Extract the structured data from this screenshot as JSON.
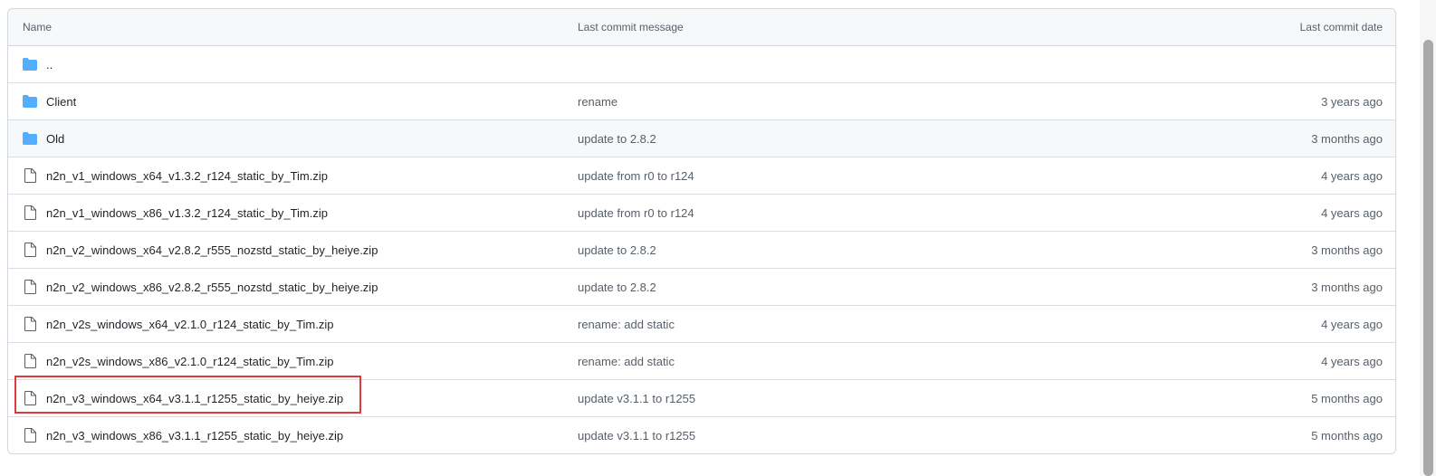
{
  "table": {
    "headers": {
      "name": "Name",
      "message": "Last commit message",
      "date": "Last commit date"
    },
    "parent_link": "..",
    "rows": [
      {
        "type": "folder",
        "icon": "folder-icon",
        "name": "Client",
        "message": "rename",
        "date": "3 years ago"
      },
      {
        "type": "folder",
        "icon": "folder-icon",
        "name": "Old",
        "message": "update to 2.8.2",
        "date": "3 months ago"
      },
      {
        "type": "file",
        "icon": "file-icon",
        "name": "n2n_v1_windows_x64_v1.3.2_r124_static_by_Tim.zip",
        "message": "update from r0 to r124",
        "date": "4 years ago"
      },
      {
        "type": "file",
        "icon": "file-icon",
        "name": "n2n_v1_windows_x86_v1.3.2_r124_static_by_Tim.zip",
        "message": "update from r0 to r124",
        "date": "4 years ago"
      },
      {
        "type": "file",
        "icon": "file-icon",
        "name": "n2n_v2_windows_x64_v2.8.2_r555_nozstd_static_by_heiye.zip",
        "message": "update to 2.8.2",
        "date": "3 months ago"
      },
      {
        "type": "file",
        "icon": "file-icon",
        "name": "n2n_v2_windows_x86_v2.8.2_r555_nozstd_static_by_heiye.zip",
        "message": "update to 2.8.2",
        "date": "3 months ago"
      },
      {
        "type": "file",
        "icon": "file-icon",
        "name": "n2n_v2s_windows_x64_v2.1.0_r124_static_by_Tim.zip",
        "message": "rename: add static",
        "date": "4 years ago"
      },
      {
        "type": "file",
        "icon": "file-icon",
        "name": "n2n_v2s_windows_x86_v2.1.0_r124_static_by_Tim.zip",
        "message": "rename: add static",
        "date": "4 years ago"
      },
      {
        "type": "file",
        "icon": "file-icon",
        "name": "n2n_v3_windows_x64_v3.1.1_r1255_static_by_heiye.zip",
        "message": "update v3.1.1 to r1255",
        "date": "5 months ago"
      },
      {
        "type": "file",
        "icon": "file-icon",
        "name": "n2n_v3_windows_x86_v3.1.1_r1255_static_by_heiye.zip",
        "message": "update v3.1.1 to r1255",
        "date": "5 months ago"
      }
    ]
  },
  "colors": {
    "folder": "#54aeff",
    "file_icon": "#57606a",
    "highlight": "#e0383e"
  }
}
